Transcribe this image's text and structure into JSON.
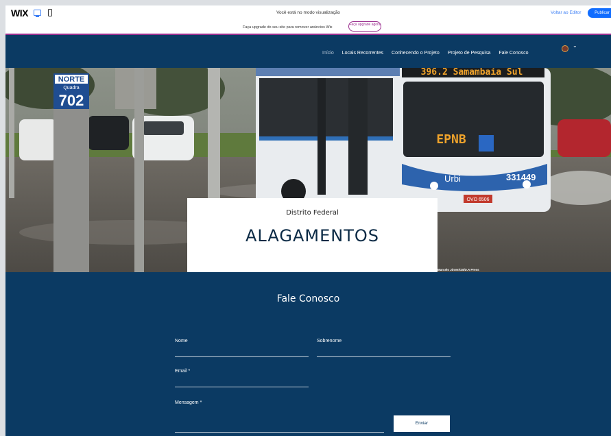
{
  "wix_bar": {
    "logo": "WIX",
    "preview_notice": "Você está no modo visualização",
    "back_to_editor": "Voltar ao Editor",
    "publish": "Publicar"
  },
  "upgrade_banner": {
    "text": "Faça upgrade do seu site para remover anúncios Wix",
    "button": "Faça upgrade agora"
  },
  "nav": {
    "items": [
      "Início",
      "Locais Recorrentes",
      "Conhecendo o Projeto",
      "Projeto de Pesquisa",
      "Fale Conosco"
    ],
    "active": "Início"
  },
  "hero": {
    "sign_north": "NORTE",
    "sign_quadra": "Quadra",
    "sign_number": "702",
    "bus_destination": "396.2 Samambaia Sul",
    "bus_operator": "EPNB",
    "bus_brand": "Urbi",
    "bus_number": "331449",
    "bus_plate": "OVO 6506",
    "subtitle": "Distrito Federal",
    "title": "ALAGAMENTOS",
    "photo_credit": "Marcelo Jinter/CB/D.A Press"
  },
  "contact": {
    "title": "Fale Conosco",
    "first_name_label": "Nome",
    "last_name_label": "Sobrenome",
    "email_label": "Email *",
    "message_label": "Mensagem *",
    "submit": "Enviar"
  },
  "colors": {
    "navy": "#0b3a63",
    "wix_blue": "#116dff",
    "upgrade_purple": "#9b2f8f"
  }
}
